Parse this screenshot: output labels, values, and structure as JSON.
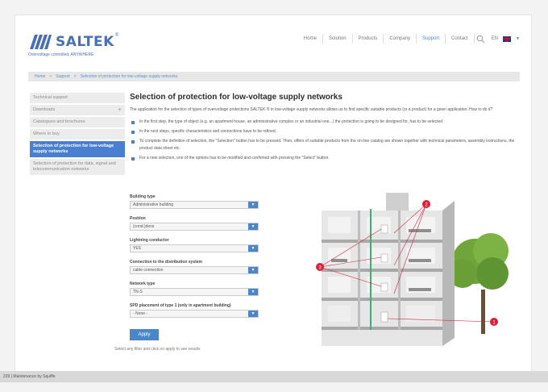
{
  "header": {
    "brand": "SALTEK",
    "trademark": "®",
    "tagline": "Overvoltage controlled, ANYWHERE",
    "nav": [
      {
        "label": "Home",
        "active": false
      },
      {
        "label": "Solution",
        "active": false
      },
      {
        "label": "Products",
        "active": false
      },
      {
        "label": "Company",
        "active": false
      },
      {
        "label": "Support",
        "active": true
      },
      {
        "label": "Contact",
        "active": false
      }
    ],
    "search_icon": "search-icon",
    "language": "EN",
    "flag_icon": "uk-flag-icon",
    "accent": "#4a86c8"
  },
  "breadcrumb": {
    "items": [
      "Home",
      "Support",
      "Selection of protection for low-voltage supply networks"
    ],
    "separator": ">"
  },
  "sidebar": {
    "items": [
      {
        "label": "Technical support",
        "active": false
      },
      {
        "label": "Downloads",
        "active": false,
        "expand": "+"
      },
      {
        "label": "Catalogues and brochures",
        "active": false
      },
      {
        "label": "Where to buy",
        "active": false
      },
      {
        "label": "Selection of protection for low-voltage supply networks",
        "active": true
      },
      {
        "label": "Selection of protection for data, signal and telecommunication networks",
        "active": false
      }
    ]
  },
  "main": {
    "title": "Selection of protection for low-voltage supply networks",
    "intro": "The application for the selection of types of overvoltage protections SALTEK ® in low-voltage supply networks allows us to find specific suitable products (or a product) for a given application. How to do it?",
    "bullets": [
      "In the first step, the type of object (e.g. an apartment house, an administrative complex or an industrial one...) the protection is going to be designed for, has to be selected.",
      "In the next steps, specific characteristics and connections have to be refined.",
      "To complete the definition of selection, the \"Selection\" button has to be pressed. Then, offers of suitable products from the on-line catalog are shown together with technical parameters, assembly instructions, the product data sheet etc.",
      "For a new selection, one of the options has to be modified and confirmed with pressing the \"Select\" button."
    ]
  },
  "form": {
    "fields": [
      {
        "label": "Building type",
        "value": "Administrative building"
      },
      {
        "label": "Position",
        "value": "(cond.)dens"
      },
      {
        "label": "Lightning conductor",
        "value": "YES"
      },
      {
        "label": "Connection to the distribution system",
        "value": "cable connection"
      },
      {
        "label": "Network type",
        "value": "TN-S"
      },
      {
        "label": "SPD placement of type 1 (only in apartment building)",
        "value": "- None -"
      }
    ],
    "apply_label": "Apply",
    "hint": "Select any filter and click on apply to see results"
  },
  "illustration": {
    "callouts": [
      "3",
      "2",
      "1"
    ],
    "marker_color": "#d9203a"
  },
  "footer": {
    "text": "229 | Maintenance by Squiffe"
  }
}
